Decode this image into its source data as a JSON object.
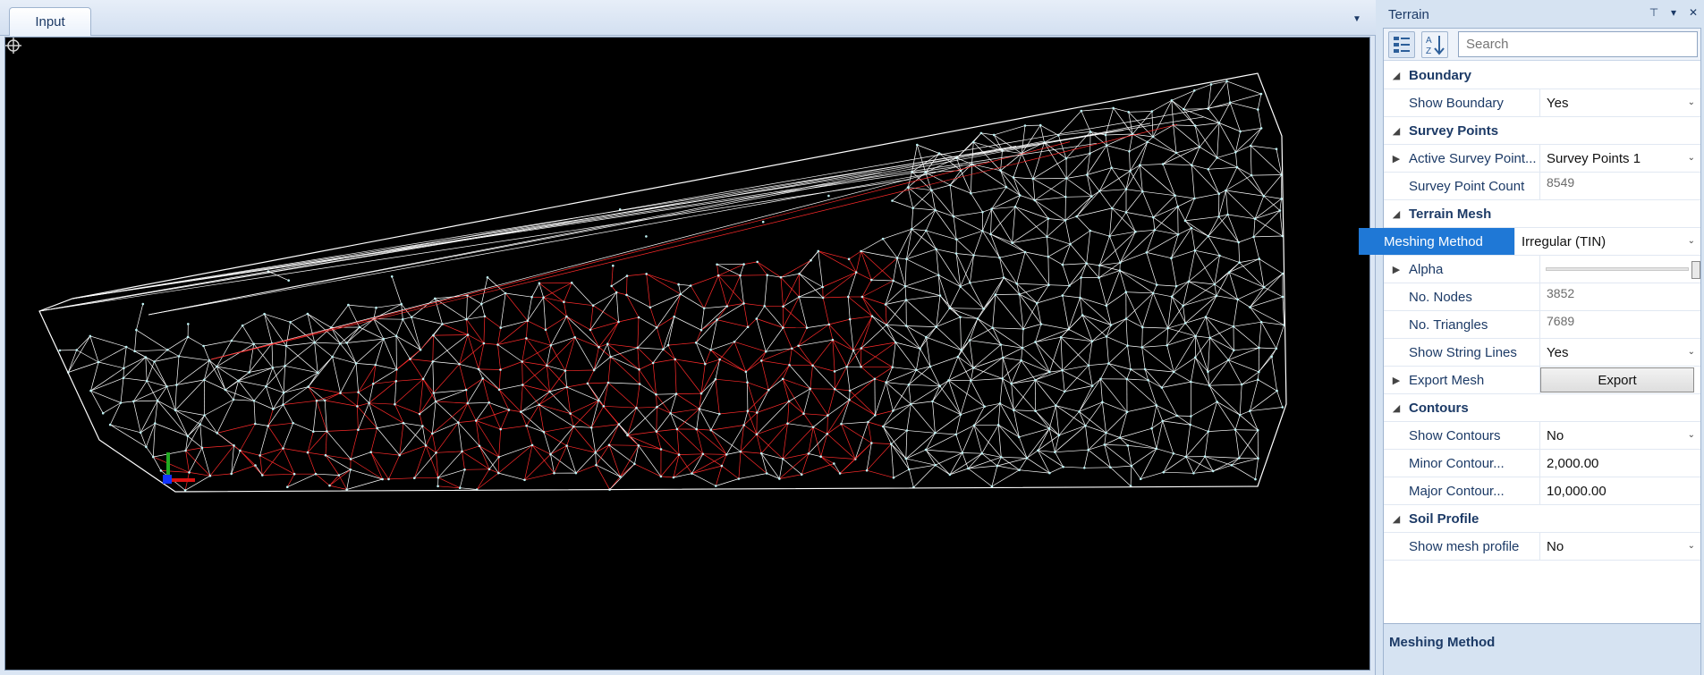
{
  "document": {
    "tab_label": "Input",
    "tab_menu_icon": "chevron-down-icon"
  },
  "panel": {
    "title": "Terrain",
    "pin_icon": "pin-icon",
    "dropdown_icon": "chevron-down-icon",
    "close_icon": "close-icon",
    "search_placeholder": "Search",
    "categories": {
      "boundary": "Boundary",
      "survey_points": "Survey Points",
      "terrain_mesh": "Terrain Mesh",
      "contours": "Contours",
      "soil_profile": "Soil Profile"
    },
    "props": {
      "show_boundary": {
        "name": "Show Boundary",
        "value": "Yes"
      },
      "active_survey_points": {
        "name": "Active Survey Point...",
        "value": "Survey Points 1"
      },
      "survey_point_count": {
        "name": "Survey Point Count",
        "value": "8549"
      },
      "meshing_method": {
        "name": "Meshing Method",
        "value": "Irregular (TIN)"
      },
      "alpha": {
        "name": "Alpha",
        "value": 1.0
      },
      "no_nodes": {
        "name": "No. Nodes",
        "value": "3852"
      },
      "no_triangles": {
        "name": "No. Triangles",
        "value": "7689"
      },
      "show_string_lines": {
        "name": "Show String Lines",
        "value": "Yes"
      },
      "export_mesh": {
        "name": "Export Mesh",
        "button": "Export"
      },
      "show_contours": {
        "name": "Show Contours",
        "value": "No"
      },
      "minor_contour": {
        "name": "Minor Contour...",
        "value": "2,000.00"
      },
      "major_contour": {
        "name": "Major Contour...",
        "value": "10,000.00"
      },
      "show_mesh_profile": {
        "name": "Show mesh profile",
        "value": "No"
      }
    },
    "description_title": "Meshing Method"
  },
  "colors": {
    "viewport_bg": "#000000",
    "mesh_line": "#ffffff",
    "mesh_node": "#bff3f5",
    "red_region": "#ff2a2a",
    "selection": "#1f78d6"
  }
}
